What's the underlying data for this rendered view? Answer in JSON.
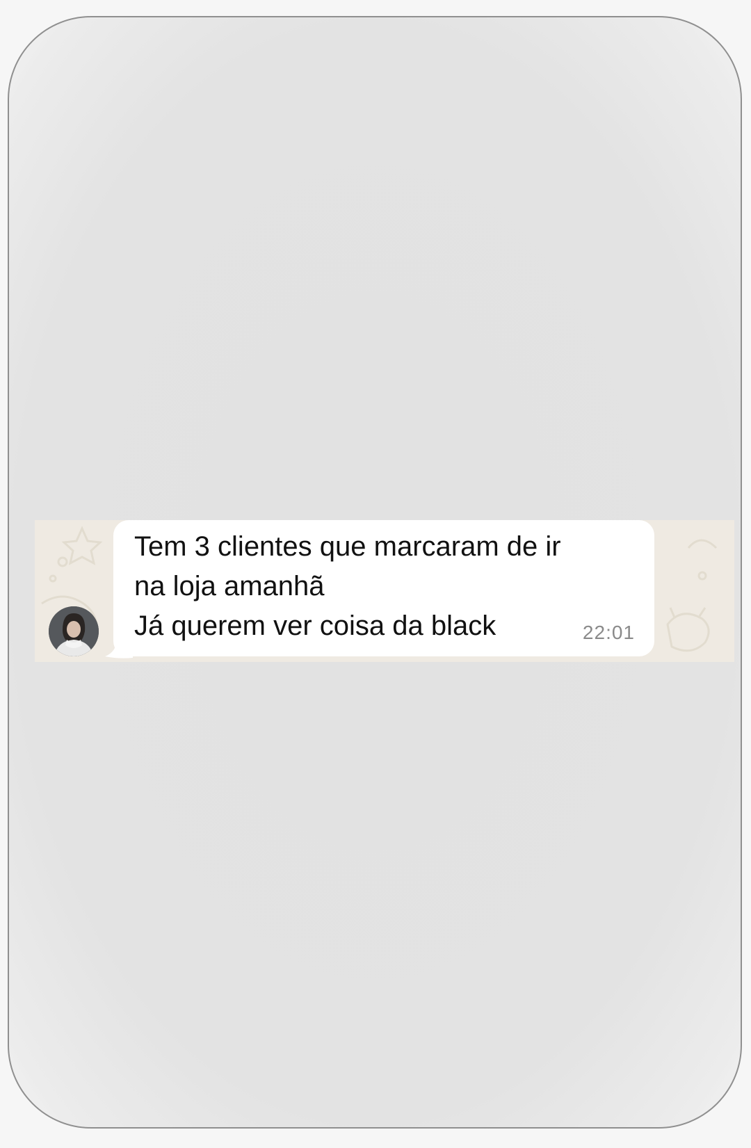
{
  "message": {
    "lines": [
      "Tem 3 clientes que marcaram de ir",
      "na loja amanhã",
      "Já querem ver coisa da black"
    ],
    "time": "22:01"
  },
  "sender": {
    "avatar_icon": "profile-photo"
  },
  "colors": {
    "chat_background": "#efeae2",
    "bubble": "#ffffff",
    "frame_border": "#8f8f8f"
  }
}
